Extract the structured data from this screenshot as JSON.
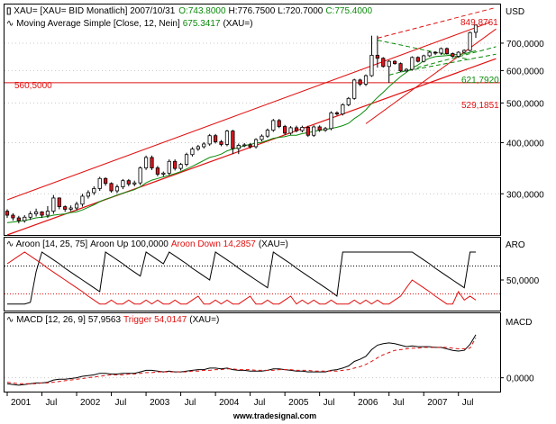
{
  "colors": {
    "frame": "#000000",
    "price_up": "#ffffff",
    "price_down": "#d9181f",
    "ma": "#0a8a0a",
    "channel": "#e01010",
    "horizontal_line": "#e01010",
    "triangle": "#0a8a0a",
    "aroon_up": "#000000",
    "aroon_down": "#e01010",
    "macd": "#000000",
    "trigger": "#e01010",
    "grid_dot": "#c8c8c8",
    "green_text": "#0a8a0a",
    "red_text": "#e01010"
  },
  "price_panel": {
    "legend_line1": {
      "symbol": "XAU= [XAU= BID Monatlich] 2007/10/31",
      "open": "O:743.8000",
      "high": "H:776.7500",
      "low": "L:720.7000",
      "close": "C:775.4000"
    },
    "legend_line2": {
      "label": "Moving Average Simple [Close, 12, Nein]",
      "value": "675.3417",
      "suffix": "(XAU=)"
    },
    "unit": "USD",
    "ticks": [
      "700,0000",
      "600,0000",
      "500,0000",
      "400,0000",
      "300,0000"
    ],
    "markers": {
      "upper_channel": "849,8761",
      "triangle_low": "621,7920",
      "lower_channel": "529,1851",
      "horizontal": "560,5000"
    }
  },
  "aroon_panel": {
    "unit": "ARO",
    "legend": {
      "label": "Aroon [14, 25, 75]",
      "up": "Aroon Up 100,0000",
      "down": "Aroon Down 14,2857",
      "suffix": "(XAU=)"
    },
    "ticks": [
      "50,0000"
    ]
  },
  "macd_panel": {
    "unit": "MACD",
    "legend": {
      "label": "MACD [12, 26, 9]",
      "value": "57,9563",
      "trigger": "Trigger 54,0147",
      "suffix": "(XAU=)"
    },
    "ticks": [
      "0,0000"
    ]
  },
  "x_axis": {
    "labels": [
      "2001",
      "Jul",
      "2002",
      "Jul",
      "2003",
      "Jul",
      "2004",
      "Jul",
      "2005",
      "Jul",
      "2006",
      "Jul",
      "2007",
      "Jul"
    ]
  },
  "footer": "www.tradesignal.com",
  "chart_data": [
    {
      "type": "candlestick",
      "title": "XAU= [XAU= BID Monatlich] 2007/10/31",
      "ylabel": "USD",
      "scale": "log",
      "ylim": [
        238,
        870
      ],
      "x_start": "2001-01",
      "x_end": "2007-10",
      "period": "monthly",
      "series": [
        {
          "name": "XAU=",
          "close": [
            266,
            262,
            258,
            263,
            268,
            271,
            266,
            272,
            293,
            279,
            275,
            277,
            283,
            296,
            302,
            309,
            327,
            318,
            305,
            312,
            323,
            317,
            319,
            347,
            368,
            347,
            335,
            337,
            360,
            346,
            354,
            374,
            386,
            391,
            397,
            416,
            402,
            396,
            427,
            387,
            394,
            395,
            391,
            407,
            415,
            429,
            453,
            438,
            422,
            435,
            428,
            436,
            417,
            437,
            429,
            433,
            473,
            470,
            495,
            513,
            569,
            556,
            583,
            654,
            643,
            614,
            632,
            624,
            599,
            604,
            646,
            632,
            652,
            665,
            662,
            679,
            660,
            650,
            665,
            672,
            743,
            775
          ],
          "open": [
            272,
            266,
            262,
            258,
            263,
            268,
            271,
            266,
            272,
            293,
            279,
            275,
            277,
            283,
            296,
            302,
            309,
            327,
            318,
            305,
            312,
            323,
            317,
            319,
            347,
            368,
            347,
            335,
            337,
            360,
            346,
            354,
            374,
            386,
            391,
            397,
            416,
            402,
            396,
            427,
            387,
            394,
            395,
            391,
            407,
            415,
            429,
            453,
            438,
            422,
            435,
            428,
            436,
            417,
            437,
            429,
            433,
            473,
            470,
            495,
            513,
            569,
            556,
            583,
            654,
            643,
            614,
            632,
            624,
            599,
            604,
            646,
            632,
            652,
            665,
            662,
            679,
            660,
            650,
            665,
            672,
            744
          ],
          "high": [
            275,
            269,
            265,
            266,
            272,
            276,
            272,
            280,
            298,
            294,
            281,
            281,
            287,
            300,
            306,
            313,
            330,
            329,
            320,
            316,
            326,
            326,
            323,
            350,
            372,
            372,
            351,
            340,
            364,
            364,
            357,
            378,
            390,
            395,
            401,
            420,
            420,
            406,
            430,
            430,
            398,
            399,
            399,
            410,
            419,
            433,
            457,
            457,
            442,
            439,
            440,
            440,
            440,
            441,
            441,
            437,
            477,
            477,
            499,
            517,
            573,
            573,
            587,
            730,
            730,
            647,
            636,
            636,
            628,
            608,
            650,
            650,
            656,
            669,
            669,
            683,
            683,
            664,
            669,
            676,
            747,
            777
          ],
          "low": [
            262,
            258,
            254,
            255,
            259,
            264,
            262,
            262,
            268,
            275,
            271,
            272,
            273,
            279,
            292,
            298,
            305,
            314,
            302,
            301,
            308,
            313,
            313,
            315,
            343,
            343,
            331,
            331,
            333,
            342,
            342,
            350,
            370,
            382,
            387,
            393,
            398,
            392,
            392,
            375,
            375,
            390,
            387,
            387,
            403,
            411,
            425,
            434,
            418,
            418,
            424,
            424,
            413,
            413,
            425,
            425,
            429,
            466,
            466,
            491,
            509,
            550,
            550,
            579,
            610,
            610,
            560,
            620,
            595,
            594,
            600,
            628,
            628,
            648,
            655,
            655,
            656,
            646,
            646,
            661,
            668,
            721
          ]
        },
        {
          "name": "Moving Average Simple [Close, 12, Nein]",
          "values": [
            255,
            256,
            257,
            258,
            260,
            262,
            263,
            264,
            266,
            267,
            268,
            270,
            271,
            274,
            278,
            282,
            287,
            291,
            294,
            298,
            301,
            304,
            307,
            312,
            319,
            324,
            327,
            330,
            333,
            336,
            340,
            345,
            350,
            356,
            362,
            368,
            371,
            375,
            382,
            386,
            389,
            393,
            396,
            399,
            401,
            405,
            410,
            412,
            414,
            417,
            417,
            421,
            423,
            426,
            429,
            431,
            433,
            436,
            440,
            446,
            458,
            468,
            481,
            499,
            516,
            531,
            548,
            564,
            580,
            594,
            609,
            619,
            634,
            643,
            649,
            651,
            653,
            656,
            657,
            659,
            665,
            671
          ]
        }
      ],
      "annotations": [
        {
          "label": "849,8761",
          "type": "upper channel line"
        },
        {
          "label": "621,7920",
          "type": "triangle lower line"
        },
        {
          "label": "529,1851",
          "type": "lower channel line"
        },
        {
          "label": "560,5000",
          "type": "horizontal line",
          "y": 560.5
        }
      ]
    },
    {
      "type": "line",
      "title": "Aroon [14, 25, 75]",
      "ylim": [
        0,
        100
      ],
      "reference_lines": [
        25,
        75
      ],
      "series": [
        {
          "name": "Aroon Up",
          "values": [
            7,
            7,
            7,
            7,
            10,
            65,
            100,
            93,
            86,
            79,
            71,
            64,
            57,
            50,
            43,
            36,
            29,
            100,
            93,
            86,
            79,
            71,
            64,
            57,
            100,
            93,
            86,
            79,
            100,
            93,
            86,
            79,
            71,
            64,
            57,
            50,
            100,
            93,
            86,
            79,
            71,
            64,
            57,
            50,
            43,
            36,
            100,
            93,
            86,
            79,
            71,
            64,
            57,
            50,
            43,
            36,
            29,
            21,
            100,
            100,
            100,
            100,
            100,
            100,
            100,
            100,
            100,
            100,
            100,
            100,
            100,
            93,
            86,
            79,
            71,
            64,
            57,
            50,
            43,
            36,
            100,
            100
          ],
          "last": 100.0
        },
        {
          "name": "Aroon Down",
          "values": [
            79,
            86,
            93,
            100,
            93,
            86,
            79,
            71,
            64,
            57,
            50,
            43,
            36,
            29,
            21,
            14,
            7,
            7,
            14,
            7,
            7,
            14,
            7,
            7,
            14,
            7,
            14,
            7,
            7,
            14,
            7,
            7,
            14,
            21,
            7,
            7,
            14,
            7,
            14,
            7,
            7,
            14,
            21,
            7,
            7,
            14,
            7,
            7,
            14,
            21,
            7,
            14,
            7,
            14,
            7,
            7,
            14,
            7,
            7,
            7,
            14,
            7,
            14,
            7,
            14,
            7,
            7,
            14,
            21,
            36,
            50,
            43,
            36,
            29,
            21,
            14,
            7,
            7,
            29,
            14,
            21,
            14
          ],
          "last": 14.2857
        }
      ]
    },
    {
      "type": "line",
      "title": "MACD [12, 26, 9]",
      "zero_line": 0,
      "series": [
        {
          "name": "MACD",
          "values": [
            -8,
            -9,
            -10,
            -9,
            -8,
            -7,
            -7,
            -6,
            -3,
            -2,
            -2,
            -1,
            0,
            2,
            3,
            4,
            6,
            6,
            5,
            5,
            6,
            6,
            6,
            8,
            10,
            10,
            9,
            8,
            9,
            8,
            8,
            9,
            10,
            11,
            11,
            13,
            13,
            12,
            13,
            11,
            10,
            10,
            9,
            9,
            9,
            10,
            12,
            12,
            11,
            10,
            9,
            9,
            8,
            8,
            8,
            8,
            10,
            11,
            13,
            16,
            22,
            25,
            29,
            38,
            44,
            46,
            47,
            46,
            44,
            42,
            43,
            42,
            42,
            42,
            41,
            41,
            39,
            37,
            36,
            37,
            45,
            58
          ],
          "last": 57.9563
        },
        {
          "name": "Trigger",
          "values": [
            -6,
            -7,
            -8,
            -8,
            -8,
            -8,
            -7,
            -7,
            -6,
            -5,
            -4,
            -3,
            -2,
            -1,
            0,
            1,
            2,
            3,
            4,
            4,
            4,
            5,
            5,
            6,
            7,
            7,
            8,
            8,
            8,
            8,
            8,
            8,
            9,
            9,
            10,
            10,
            11,
            11,
            12,
            12,
            11,
            11,
            11,
            10,
            10,
            10,
            10,
            11,
            11,
            11,
            10,
            10,
            10,
            9,
            9,
            9,
            9,
            9,
            10,
            11,
            13,
            15,
            18,
            22,
            27,
            31,
            34,
            37,
            38,
            39,
            40,
            40,
            41,
            41,
            41,
            41,
            41,
            40,
            39,
            39,
            40,
            54
          ],
          "last": 54.0147
        }
      ]
    }
  ]
}
